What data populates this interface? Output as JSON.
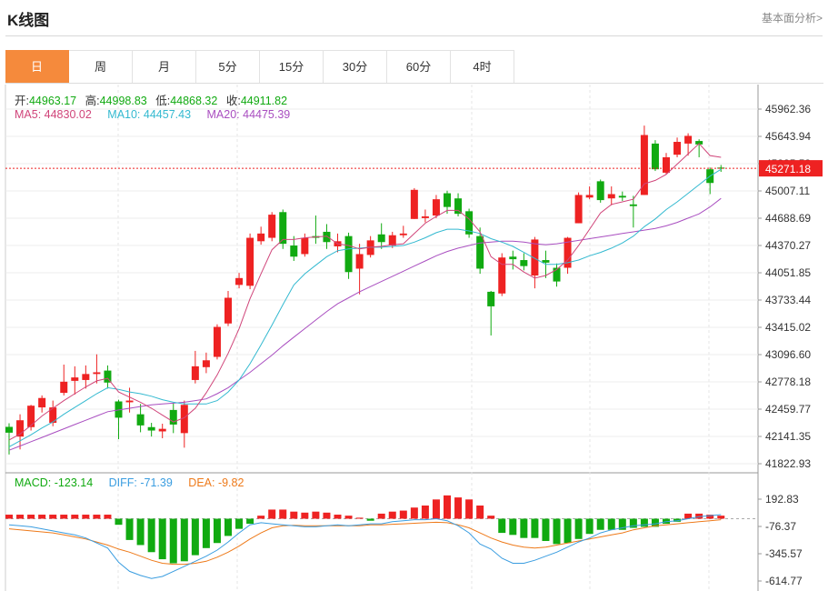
{
  "header": {
    "title": "K线图",
    "more_link": "基本面分析>"
  },
  "tabs": [
    "日",
    "周",
    "月",
    "5分",
    "15分",
    "30分",
    "60分",
    "4时"
  ],
  "active_tab": "日",
  "ohlc_info": {
    "open_label": "开:",
    "open": "44963.17",
    "high_label": "高:",
    "high": "44998.83",
    "low_label": "低:",
    "low": "44868.32",
    "close_label": "收:",
    "close": "44911.82"
  },
  "ma_info": {
    "ma5": "MA5: 44830.02",
    "ma10": "MA10: 44457.43",
    "ma20": "MA20: 44475.39"
  },
  "macd_info": {
    "macd": "MACD: -123.14",
    "diff": "DIFF: -71.39",
    "dea": "DEA: -9.82"
  },
  "current_price_label": "45271.18",
  "colors": {
    "up": "#ee2222",
    "down": "#11aa11",
    "ma5": "#d0457a",
    "ma10": "#33b9d0",
    "ma20": "#a94ec0",
    "diff": "#3a9de0",
    "dea": "#ee7a1a",
    "accent": "#f58a3c"
  },
  "chart_data": [
    {
      "type": "candlestick",
      "y_ticks": [
        "45962.36",
        "45643.94",
        "45325.53",
        "45007.11",
        "44688.69",
        "44370.27",
        "44051.85",
        "43733.44",
        "43415.02",
        "43096.60",
        "42778.18",
        "42459.77",
        "42141.35",
        "41822.93"
      ],
      "ylim": [
        41822.93,
        46117
      ],
      "current_price": 45271.18,
      "candles": [
        [
          42253,
          42185,
          42295,
          41930
        ],
        [
          42140,
          42330,
          42400,
          41990
        ],
        [
          42250,
          42500,
          42510,
          42210
        ],
        [
          42480,
          42590,
          42620,
          42420
        ],
        [
          42300,
          42480,
          42560,
          42260
        ],
        [
          42650,
          42780,
          42980,
          42620
        ],
        [
          42790,
          42830,
          42960,
          42630
        ],
        [
          42800,
          42870,
          42970,
          42700
        ],
        [
          42870,
          42890,
          43100,
          42760
        ],
        [
          42910,
          42770,
          42970,
          42700
        ],
        [
          42550,
          42360,
          42570,
          42110
        ],
        [
          42540,
          42560,
          42710,
          42420
        ],
        [
          42400,
          42270,
          42520,
          42190
        ],
        [
          42250,
          42210,
          42300,
          42140
        ],
        [
          42200,
          42230,
          42290,
          42120
        ],
        [
          42450,
          42280,
          42530,
          42180
        ],
        [
          42180,
          42510,
          42560,
          42010
        ],
        [
          42800,
          42960,
          43140,
          42760
        ],
        [
          42950,
          43030,
          43120,
          42880
        ],
        [
          43070,
          43420,
          43450,
          43040
        ],
        [
          43460,
          43760,
          43840,
          43430
        ],
        [
          43910,
          43990,
          44050,
          43870
        ],
        [
          43900,
          44460,
          44510,
          43860
        ],
        [
          44420,
          44510,
          44590,
          44380
        ],
        [
          44460,
          44730,
          44760,
          44420
        ],
        [
          44760,
          44390,
          44790,
          44330
        ],
        [
          44370,
          44240,
          44480,
          44190
        ],
        [
          44270,
          44460,
          44510,
          44240
        ],
        [
          44480,
          44460,
          44720,
          44390
        ],
        [
          44530,
          44410,
          44620,
          44330
        ],
        [
          44360,
          44420,
          44510,
          44290
        ],
        [
          44480,
          44060,
          44520,
          43980
        ],
        [
          44100,
          44270,
          44390,
          43800
        ],
        [
          44260,
          44430,
          44480,
          44230
        ],
        [
          44500,
          44410,
          44630,
          44330
        ],
        [
          44370,
          44490,
          44530,
          44340
        ],
        [
          44490,
          44510,
          44600,
          44460
        ],
        [
          44680,
          45020,
          45040,
          44680
        ],
        [
          44690,
          44710,
          44790,
          44640
        ],
        [
          44720,
          44910,
          44960,
          44690
        ],
        [
          44980,
          44820,
          45010,
          44740
        ],
        [
          44920,
          44740,
          44980,
          44710
        ],
        [
          44770,
          44500,
          44800,
          44460
        ],
        [
          44480,
          44100,
          44580,
          44040
        ],
        [
          43830,
          43660,
          43840,
          43320
        ],
        [
          43810,
          44230,
          44280,
          43780
        ],
        [
          44240,
          44210,
          44310,
          44090
        ],
        [
          44200,
          44130,
          44280,
          44080
        ],
        [
          44020,
          44440,
          44470,
          43870
        ],
        [
          44200,
          44170,
          44310,
          43990
        ],
        [
          44110,
          43950,
          44160,
          43890
        ],
        [
          44110,
          44460,
          44470,
          44040
        ],
        [
          44630,
          44960,
          44990,
          44630
        ],
        [
          44930,
          44960,
          45060,
          44910
        ],
        [
          45120,
          44900,
          45140,
          44870
        ],
        [
          44920,
          44970,
          45060,
          44840
        ],
        [
          44950,
          44930,
          45000,
          44890
        ],
        [
          44850,
          44830,
          44950,
          44580
        ],
        [
          44960,
          45660,
          45770,
          44960
        ],
        [
          45560,
          45260,
          45600,
          45240
        ],
        [
          45220,
          45400,
          45450,
          45200
        ],
        [
          45430,
          45580,
          45630,
          45400
        ],
        [
          45560,
          45650,
          45680,
          45420
        ],
        [
          45590,
          45550,
          45610,
          45400
        ],
        [
          45260,
          45100,
          45280,
          44970
        ],
        [
          45280,
          45270,
          45310,
          45230
        ]
      ],
      "ma5": [
        42100,
        42170,
        42270,
        42380,
        42470,
        42560,
        42640,
        42720,
        42790,
        42820,
        42660,
        42600,
        42540,
        42470,
        42390,
        42310,
        42360,
        42470,
        42650,
        42860,
        43110,
        43400,
        43750,
        44040,
        44320,
        44440,
        44440,
        44460,
        44470,
        44480,
        44390,
        44370,
        44330,
        44350,
        44360,
        44380,
        44390,
        44510,
        44630,
        44710,
        44780,
        44780,
        44680,
        44530,
        44240,
        44150,
        44150,
        44060,
        43990,
        44020,
        44090,
        44200,
        44370,
        44560,
        44750,
        44850,
        44880,
        44910,
        45090,
        45130,
        45200,
        45320,
        45440,
        45560,
        45420,
        45400
      ],
      "ma10": [
        42020,
        42090,
        42160,
        42240,
        42310,
        42400,
        42480,
        42560,
        42640,
        42710,
        42690,
        42660,
        42640,
        42610,
        42570,
        42540,
        42520,
        42520,
        42520,
        42560,
        42660,
        42800,
        42990,
        43210,
        43440,
        43680,
        43910,
        44040,
        44140,
        44240,
        44310,
        44330,
        44340,
        44350,
        44350,
        44360,
        44370,
        44410,
        44460,
        44520,
        44560,
        44560,
        44540,
        44510,
        44450,
        44410,
        44360,
        44290,
        44220,
        44150,
        44150,
        44170,
        44200,
        44250,
        44290,
        44340,
        44400,
        44480,
        44590,
        44680,
        44790,
        44880,
        44980,
        45080,
        45180,
        45260
      ],
      "ma20": [
        41980,
        42030,
        42080,
        42130,
        42180,
        42230,
        42280,
        42330,
        42380,
        42430,
        42450,
        42470,
        42490,
        42510,
        42520,
        42530,
        42540,
        42560,
        42580,
        42640,
        42710,
        42800,
        42890,
        42990,
        43090,
        43200,
        43300,
        43400,
        43500,
        43600,
        43690,
        43760,
        43830,
        43890,
        43950,
        44010,
        44070,
        44130,
        44190,
        44250,
        44300,
        44340,
        44370,
        44400,
        44410,
        44420,
        44420,
        44410,
        44390,
        44380,
        44390,
        44410,
        44430,
        44450,
        44470,
        44490,
        44510,
        44530,
        44550,
        44570,
        44600,
        44640,
        44690,
        44740,
        44820,
        44920
      ]
    },
    {
      "type": "macd",
      "y_ticks": [
        "192.83",
        "-76.37",
        "-345.57",
        "-614.77"
      ],
      "ylim": [
        -614.77,
        192.83
      ],
      "hist": [
        40,
        40,
        40,
        40,
        40,
        40,
        40,
        40,
        40,
        40,
        -60,
        -210,
        -260,
        -330,
        -400,
        -440,
        -420,
        -360,
        -290,
        -240,
        -170,
        -100,
        -50,
        30,
        90,
        90,
        70,
        60,
        70,
        60,
        40,
        30,
        10,
        -20,
        50,
        70,
        80,
        110,
        130,
        190,
        230,
        210,
        190,
        130,
        30,
        -140,
        -160,
        -190,
        -190,
        -220,
        -250,
        -240,
        -200,
        -150,
        -110,
        -110,
        -110,
        -90,
        -80,
        -80,
        -50,
        -30,
        50,
        50,
        40,
        30
      ],
      "diff": [
        -60,
        -70,
        -80,
        -100,
        -120,
        -140,
        -160,
        -190,
        -240,
        -290,
        -430,
        -520,
        -560,
        -590,
        -570,
        -520,
        -470,
        -420,
        -370,
        -310,
        -230,
        -140,
        -60,
        -40,
        -50,
        -60,
        -70,
        -80,
        -80,
        -70,
        -60,
        -70,
        -60,
        -50,
        -50,
        -30,
        -20,
        -10,
        -10,
        0,
        -20,
        -70,
        -140,
        -250,
        -300,
        -390,
        -440,
        -440,
        -410,
        -370,
        -330,
        -280,
        -230,
        -190,
        -140,
        -110,
        -90,
        -70,
        -60,
        -50,
        -30,
        -20,
        0,
        20,
        30,
        40
      ],
      "dea": [
        -100,
        -110,
        -120,
        -130,
        -140,
        -160,
        -180,
        -200,
        -230,
        -260,
        -300,
        -330,
        -370,
        -410,
        -440,
        -450,
        -450,
        -440,
        -420,
        -380,
        -330,
        -270,
        -200,
        -140,
        -90,
        -70,
        -65,
        -70,
        -70,
        -70,
        -70,
        -70,
        -70,
        -60,
        -60,
        -55,
        -50,
        -45,
        -40,
        -35,
        -40,
        -60,
        -90,
        -140,
        -190,
        -230,
        -260,
        -280,
        -290,
        -280,
        -260,
        -240,
        -220,
        -200,
        -180,
        -160,
        -140,
        -110,
        -90,
        -70,
        -60,
        -50,
        -40,
        -30,
        -20,
        -10
      ]
    }
  ]
}
